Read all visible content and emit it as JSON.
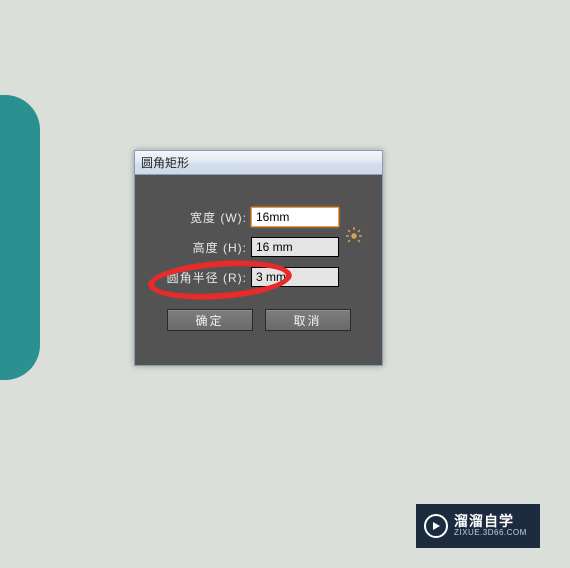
{
  "canvas": {
    "shape_color": "#2b9090"
  },
  "dialog": {
    "title": "圆角矩形",
    "fields": {
      "width": {
        "label": "宽度 (W):",
        "value": "16mm"
      },
      "height": {
        "label": "高度 (H):",
        "value": "16 mm"
      },
      "radius": {
        "label": "圆角半径 (R):",
        "value": "3 mm"
      }
    },
    "buttons": {
      "ok": "确定",
      "cancel": "取消"
    }
  },
  "watermark": {
    "main": "溜溜自学",
    "sub": "ZIXUE.3D66.COM"
  }
}
